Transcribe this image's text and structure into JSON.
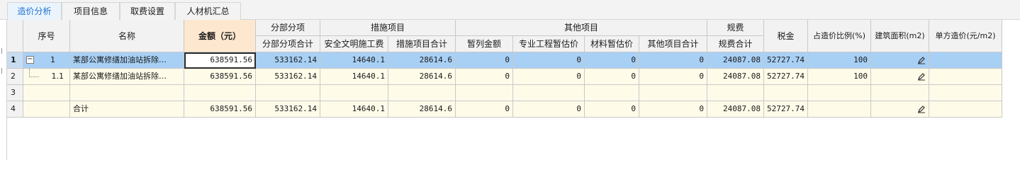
{
  "tabs": [
    {
      "label": "造价分析",
      "active": true
    },
    {
      "label": "项目信息",
      "active": false
    },
    {
      "label": "取费设置",
      "active": false
    },
    {
      "label": "人材机汇总",
      "active": false
    }
  ],
  "headers": {
    "seq": "序号",
    "name": "名称",
    "amount": "金额（元）",
    "fbfx_group": "分部分项",
    "fbfx_total": "分部分项合计",
    "cs_group": "措施项目",
    "aqwm": "安全文明施工费",
    "cs_total": "措施项目合计",
    "qt_group": "其他项目",
    "zljr": "暂列金额",
    "zygc": "专业工程暂估价",
    "clzg": "材料暂估价",
    "qt_total": "其他项目合计",
    "gf_group": "规费",
    "gf_total": "规费合计",
    "tax": "税金",
    "ratio": "占造价比例(%)",
    "area": "建筑面积(m2)",
    "unit_cost": "单方造价(元/m2)"
  },
  "rows": [
    {
      "rownum": "1",
      "seq": "1",
      "name": "某部公寓修缮加油站拆除…",
      "amount": "638591.56",
      "fbfx_total": "533162.14",
      "aqwm": "14640.1",
      "cs_total": "28614.6",
      "zljr": "0",
      "zygc": "0",
      "clzg": "0",
      "qt_total": "0",
      "gf_total": "24087.08",
      "tax": "52727.74",
      "ratio": "100",
      "area_icon": "pencil-icon",
      "unit_cost": ""
    },
    {
      "rownum": "2",
      "seq": "1.1",
      "name": "某部公寓修缮加油站拆除…",
      "amount": "638591.56",
      "fbfx_total": "533162.14",
      "aqwm": "14640.1",
      "cs_total": "28614.6",
      "zljr": "0",
      "zygc": "0",
      "clzg": "0",
      "qt_total": "0",
      "gf_total": "24087.08",
      "tax": "52727.74",
      "ratio": "100",
      "area_icon": "pencil-icon",
      "unit_cost": ""
    },
    {
      "rownum": "3",
      "seq": "",
      "name": "",
      "amount": "",
      "fbfx_total": "",
      "aqwm": "",
      "cs_total": "",
      "zljr": "",
      "zygc": "",
      "clzg": "",
      "qt_total": "",
      "gf_total": "",
      "tax": "",
      "ratio": "",
      "unit_cost": ""
    },
    {
      "rownum": "4",
      "seq": "",
      "name": "合计",
      "amount": "638591.56",
      "fbfx_total": "533162.14",
      "aqwm": "14640.1",
      "cs_total": "28614.6",
      "zljr": "0",
      "zygc": "0",
      "clzg": "0",
      "qt_total": "0",
      "gf_total": "24087.08",
      "tax": "52727.74",
      "ratio": "",
      "area_icon": "pencil-icon",
      "unit_cost": ""
    }
  ],
  "expander_symbol": "−",
  "colors": {
    "selected_row": "#a8d0f5",
    "normal_row": "#fffbe9",
    "header": "#f2f2f2",
    "amount_header": "#fde8cf",
    "active_tab_text": "#1e6fd0"
  }
}
